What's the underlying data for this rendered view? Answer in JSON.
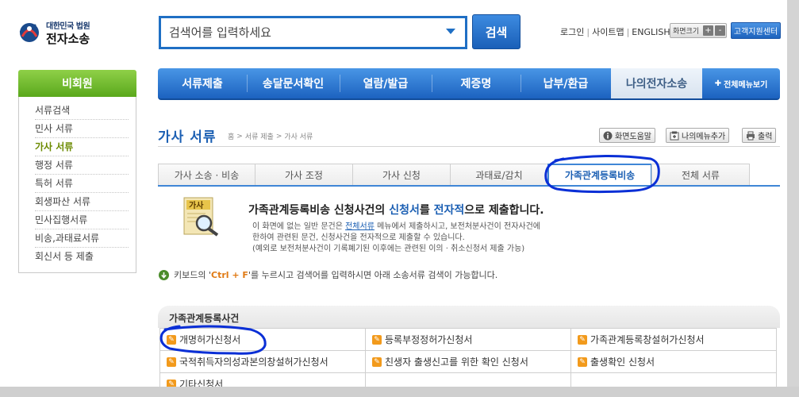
{
  "header": {
    "logo_small": "대한민국 법원",
    "logo_big": "전자소송",
    "search_placeholder": "검색어를 입력하세요",
    "search_button": "검색",
    "util_links": [
      "로그인",
      "사이트맵",
      "ENGLISH"
    ],
    "font_size_label": "화면크기",
    "font_plus": "+",
    "font_minus": "-",
    "support_button": "고객지원센터"
  },
  "sidebar": {
    "title": "비회원",
    "items": [
      {
        "label": "서류검색"
      },
      {
        "label": "민사 서류"
      },
      {
        "label": "가사 서류"
      },
      {
        "label": "행정 서류"
      },
      {
        "label": "특허 서류"
      },
      {
        "label": "회생파산 서류"
      },
      {
        "label": "민사집행서류"
      },
      {
        "label": "비송,과태료서류"
      },
      {
        "label": "회신서 등 제출"
      }
    ],
    "active_index": 2
  },
  "nav": {
    "items": [
      "서류제출",
      "송달문서확인",
      "열람/발급",
      "제증명",
      "납부/환급",
      "나의전자소송"
    ],
    "current_index": 5,
    "all_menu": "전체메뉴보기"
  },
  "page": {
    "title": "가사 서류",
    "breadcrumb": [
      "홈",
      ">",
      "서류 제출",
      ">",
      "가사 서류"
    ],
    "tools": [
      "화면도움말",
      "나의메뉴추가",
      "출력"
    ]
  },
  "subtabs": {
    "items": [
      "가사 소송 · 비송",
      "가사 조정",
      "가사 신청",
      "과태료/감치",
      "가족관계등록비송",
      "전체 서류"
    ],
    "selected_index": 4
  },
  "intro": {
    "icon_label": "가사",
    "title_a": "가족관계등록비송 신청사건의 ",
    "title_hl1": "신청서",
    "title_b": "를 ",
    "title_hl2": "전자적",
    "title_c": "으로 제출합니다.",
    "line1_a": "이 화면에 없는 일반 문건은 ",
    "line1_link": "전체서류",
    "line1_b": " 메뉴에서 제출하시고, 보전처분사건이 전자사건에",
    "line2": "한하여 관련된 문건, 신청사건을 전자적으로 제출할 수 있습니다.",
    "line3": "(예외로 보전처분사건이 기록폐기된 이후에는 관련된 이의 · 취소신청서 제출 가능)"
  },
  "kb_tip": {
    "a": "키보드의 '",
    "keys": "Ctrl + F",
    "b": "'를 누르시고 검색어를 입력하시면 아래 소송서류 검색이 가능합니다."
  },
  "section": {
    "title": "가족관계등록사건",
    "rows": [
      [
        "개명허가신청서",
        "등록부정정허가신청서",
        "가족관계등록창설허가신청서"
      ],
      [
        "국적취득자의성과본의창설허가신청서",
        "친생자 출생신고를 위한 확인 신청서",
        "출생확인 신청서"
      ],
      [
        "기타신청서",
        "",
        ""
      ]
    ]
  },
  "colors": {
    "brand_blue": "#1f6fc4",
    "sidebar_green": "#6cb52a",
    "annotation_blue": "#0a2fd6",
    "orange": "#f29a1c"
  }
}
